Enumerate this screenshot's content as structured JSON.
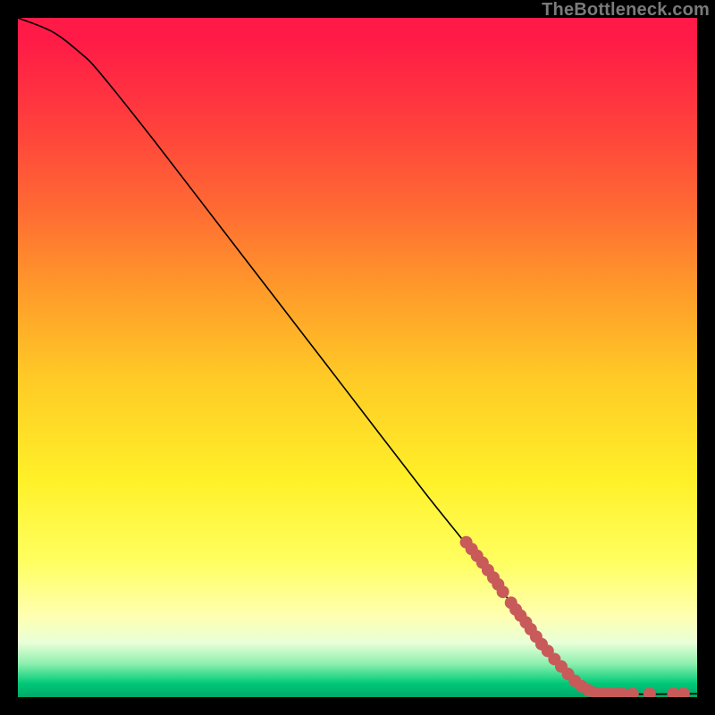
{
  "watermark": "TheBottleneck.com",
  "chart_data": {
    "type": "line",
    "title": "",
    "xlabel": "",
    "ylabel": "",
    "xlim": [
      0,
      100
    ],
    "ylim": [
      0,
      100
    ],
    "grid": false,
    "curve": [
      {
        "x": 0,
        "y": 100
      },
      {
        "x": 5,
        "y": 98
      },
      {
        "x": 9,
        "y": 95
      },
      {
        "x": 12,
        "y": 92
      },
      {
        "x": 20,
        "y": 82
      },
      {
        "x": 30,
        "y": 69
      },
      {
        "x": 40,
        "y": 56
      },
      {
        "x": 50,
        "y": 43
      },
      {
        "x": 60,
        "y": 30
      },
      {
        "x": 68,
        "y": 20
      },
      {
        "x": 74,
        "y": 12
      },
      {
        "x": 78,
        "y": 7
      },
      {
        "x": 81,
        "y": 3.5
      },
      {
        "x": 83,
        "y": 1.5
      },
      {
        "x": 85,
        "y": 0.5
      },
      {
        "x": 100,
        "y": 0.5
      }
    ],
    "markers": [
      {
        "x": 66.0,
        "y": 22.8
      },
      {
        "x": 66.8,
        "y": 21.8
      },
      {
        "x": 67.6,
        "y": 20.8
      },
      {
        "x": 68.4,
        "y": 19.8
      },
      {
        "x": 69.2,
        "y": 18.7
      },
      {
        "x": 70.0,
        "y": 17.6
      },
      {
        "x": 70.7,
        "y": 16.6
      },
      {
        "x": 71.4,
        "y": 15.5
      },
      {
        "x": 72.6,
        "y": 13.9
      },
      {
        "x": 73.3,
        "y": 12.9
      },
      {
        "x": 74.0,
        "y": 12.0
      },
      {
        "x": 74.8,
        "y": 11.0
      },
      {
        "x": 75.5,
        "y": 10.0
      },
      {
        "x": 76.3,
        "y": 8.9
      },
      {
        "x": 77.1,
        "y": 7.8
      },
      {
        "x": 78.0,
        "y": 6.8
      },
      {
        "x": 79.0,
        "y": 5.6
      },
      {
        "x": 80.0,
        "y": 4.5
      },
      {
        "x": 81.0,
        "y": 3.4
      },
      {
        "x": 82.0,
        "y": 2.4
      },
      {
        "x": 83.0,
        "y": 1.6
      },
      {
        "x": 84.0,
        "y": 1.0
      },
      {
        "x": 85.0,
        "y": 0.6
      },
      {
        "x": 86.0,
        "y": 0.5
      },
      {
        "x": 87.0,
        "y": 0.5
      },
      {
        "x": 88.0,
        "y": 0.5
      },
      {
        "x": 89.0,
        "y": 0.5
      },
      {
        "x": 90.5,
        "y": 0.5
      },
      {
        "x": 93.0,
        "y": 0.5
      },
      {
        "x": 96.5,
        "y": 0.5
      },
      {
        "x": 98.0,
        "y": 0.5
      }
    ]
  }
}
